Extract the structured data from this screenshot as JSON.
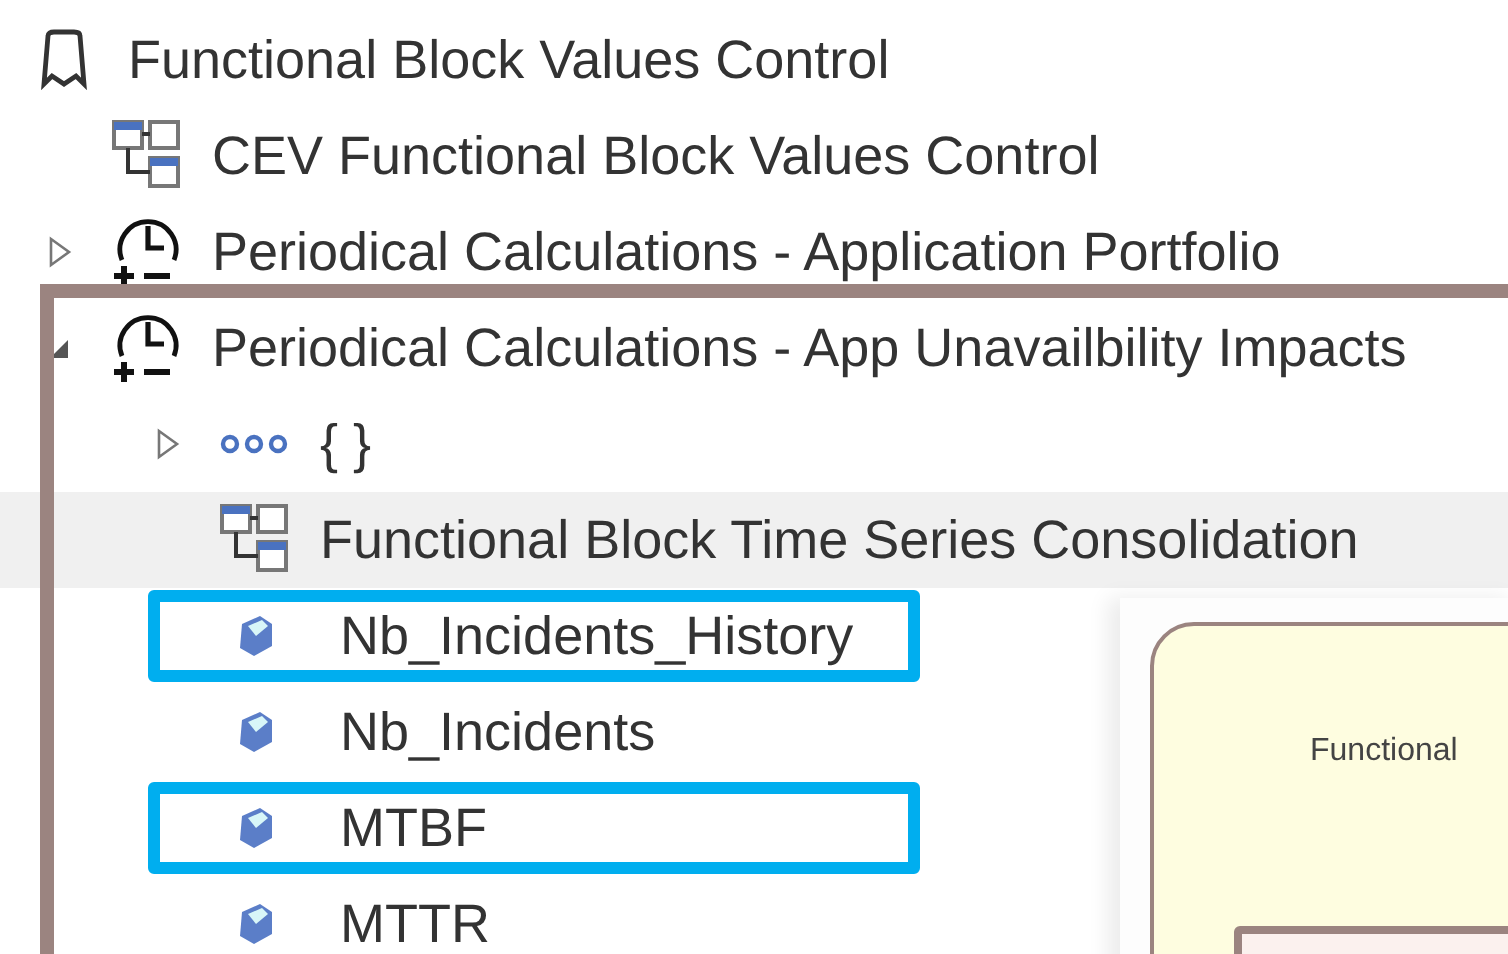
{
  "tree": [
    {
      "label": "Functional Block Values Control",
      "kind": "book",
      "selected": false,
      "highlighted": false,
      "outlined": false,
      "children": [
        {
          "label": "CEV Functional Block Values Control",
          "kind": "block",
          "selected": false,
          "highlighted": false,
          "outlined": false
        },
        {
          "label": "Periodical Calculations - Application Portfolio",
          "kind": "clock",
          "expanded": false,
          "selected": false,
          "highlighted": false,
          "outlined": false
        },
        {
          "label": "Periodical Calculations - App Unavailbility Impacts",
          "kind": "clock",
          "expanded": true,
          "selected": false,
          "highlighted": false,
          "outlined": true,
          "children": [
            {
              "label": "{ }",
              "kind": "group",
              "expanded": false,
              "selected": false,
              "highlighted": false,
              "outlined": false
            },
            {
              "label": "Functional Block Time Series Consolidation",
              "kind": "block",
              "selected": true,
              "highlighted": false,
              "outlined": false
            },
            {
              "label": "Nb_Incidents_History",
              "kind": "attribute",
              "selected": false,
              "highlighted": true,
              "outlined": false
            },
            {
              "label": "Nb_Incidents",
              "kind": "attribute",
              "selected": false,
              "highlighted": false,
              "outlined": false
            },
            {
              "label": "MTBF",
              "kind": "attribute",
              "selected": false,
              "highlighted": true,
              "outlined": false
            },
            {
              "label": "MTTR",
              "kind": "attribute",
              "selected": false,
              "highlighted": false,
              "outlined": false
            }
          ]
        }
      ]
    }
  ],
  "diagram": {
    "node_label": "Functional"
  }
}
